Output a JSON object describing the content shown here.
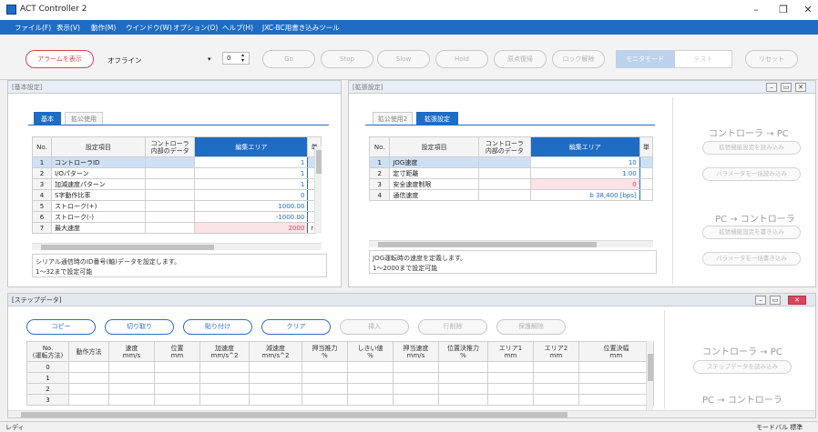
{
  "window": {
    "title": "ACT Controller 2",
    "minimize": "–",
    "maximize": "❐",
    "close": "✕"
  },
  "menu": [
    "ファイル(F)",
    "表示(V)",
    "動作(M)",
    "ウインドウ(W)",
    "オプション(O)",
    "ヘルプ(H)",
    "JXC-BC用書き込みツール"
  ],
  "toolbar": {
    "alarm_button": "アラームを表示",
    "status": "オフライン",
    "axis_value": "0",
    "buttons": [
      "Go",
      "Stop",
      "Slow",
      "Hold",
      "原点復帰",
      "ロック解除"
    ],
    "monitor_mode": "モニタモード",
    "test_mode": "テスト",
    "reset": "リセット"
  },
  "basic_panel": {
    "title": "[基本設定]",
    "tabs": [
      "基本",
      "拡公使用"
    ],
    "columns": [
      "No.",
      "設定項目",
      "コントローラ\n内部のデータ",
      "編集エリア",
      "単"
    ],
    "rows": [
      {
        "no": "1",
        "item": "コントローラID",
        "value": "1"
      },
      {
        "no": "2",
        "item": "I/Oパターン",
        "value": "1"
      },
      {
        "no": "3",
        "item": "加減速度パターン",
        "value": "1"
      },
      {
        "no": "4",
        "item": "S字動作比率",
        "value": "0"
      },
      {
        "no": "5",
        "item": "ストローク(+)",
        "value": "1000.00"
      },
      {
        "no": "6",
        "item": "ストローク(-)",
        "value": "-1000.00"
      },
      {
        "no": "7",
        "item": "最大速度",
        "value": "2000"
      }
    ],
    "row7_unit": "r",
    "description": [
      "シリアル通信時のID番号(軸)データを設定します。",
      "1～32まで設定可能"
    ]
  },
  "ext_panel": {
    "title": "[拡張設定]",
    "tabs": [
      "拡公使用2",
      "拡張設定"
    ],
    "columns": [
      "No.",
      "設定項目",
      "コントローラ\n内部のデータ",
      "編集エリア",
      "単"
    ],
    "rows": [
      {
        "no": "1",
        "item": "JOG速度",
        "value": "10"
      },
      {
        "no": "2",
        "item": "定寸距離",
        "value": "1.00"
      },
      {
        "no": "3",
        "item": "安全速度制限",
        "value": "0"
      },
      {
        "no": "4",
        "item": "通信速度",
        "value": "b 38,400 [bps]"
      }
    ],
    "description": [
      "JOG運転時の速度を定義します。",
      "1～2000まで設定可能"
    ]
  },
  "side_top": {
    "title1": "コントローラ → PC",
    "btn1": "拡張機能設定を読み込み",
    "btn2": "パラメータを一括読み込み",
    "title2": "PC → コントローラ",
    "btn3": "拡張機能設定を書き込み",
    "btn4": "パラメータを一括書き込み"
  },
  "step_panel": {
    "title": "[ステップデータ]",
    "buttons": [
      "コピー",
      "切り取り",
      "貼り付け",
      "クリア",
      "挿入",
      "行削除",
      "保護解除"
    ],
    "columns": [
      "No.\n(運転方法)",
      "動作方法",
      "速度\nmm/s",
      "位置\nmm",
      "加速度\nmm/s^2",
      "減速度\nmm/s^2",
      "押当推力\n%",
      "しきい値\n%",
      "押当速度\nmm/s",
      "位置決推力\n%",
      "エリア1\nmm",
      "エリア2\nmm",
      "位置決幅\nmm"
    ],
    "rows": [
      "0",
      "1",
      "2",
      "3"
    ]
  },
  "side_bottom": {
    "title1": "コントローラ → PC",
    "btn1": "ステップデータを読み込み",
    "title2": "PC → コントローラ"
  },
  "status": {
    "left": "レディ",
    "right": "モードバル 標準"
  },
  "colors": {
    "accent": "#1f6cc4",
    "alarm": "#d9465b"
  }
}
